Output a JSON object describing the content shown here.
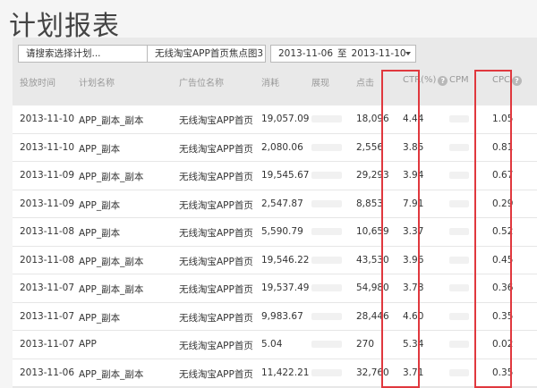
{
  "page": {
    "title": "计划报表"
  },
  "toolbar": {
    "plan_select": "请搜索选择计划...",
    "position_select": "无线淘宝APP首页焦点图3",
    "date_start": "2013-11-06",
    "date_sep": "至",
    "date_end": "2013-11-10"
  },
  "table": {
    "headers": {
      "date": "投放时间",
      "plan": "计划名称",
      "position": "广告位名称",
      "cost": "消耗",
      "impressions": "展现",
      "clicks": "点击",
      "ctr": "CTR(%)",
      "cpm": "CPM",
      "cpc": "CPC"
    },
    "rows": [
      {
        "date": "2013-11-10",
        "plan": "APP_副本_副本",
        "position": "无线淘宝APP首页",
        "cost": "19,057.09",
        "clicks": "18,096",
        "ctr": "4.44",
        "cpc": "1.05"
      },
      {
        "date": "2013-11-10",
        "plan": "APP_副本",
        "position": "无线淘宝APP首页",
        "cost": "2,080.06",
        "clicks": "2,556",
        "ctr": "3.85",
        "cpc": "0.81"
      },
      {
        "date": "2013-11-09",
        "plan": "APP_副本_副本",
        "position": "无线淘宝APP首页",
        "cost": "19,545.67",
        "clicks": "29,293",
        "ctr": "3.94",
        "cpc": "0.67"
      },
      {
        "date": "2013-11-09",
        "plan": "APP_副本",
        "position": "无线淘宝APP首页",
        "cost": "2,547.87",
        "clicks": "8,853",
        "ctr": "7.91",
        "cpc": "0.29"
      },
      {
        "date": "2013-11-08",
        "plan": "APP_副本",
        "position": "无线淘宝APP首页",
        "cost": "5,590.79",
        "clicks": "10,659",
        "ctr": "3.37",
        "cpc": "0.52"
      },
      {
        "date": "2013-11-08",
        "plan": "APP_副本_副本",
        "position": "无线淘宝APP首页",
        "cost": "19,546.22",
        "clicks": "43,530",
        "ctr": "3.96",
        "cpc": "0.45"
      },
      {
        "date": "2013-11-07",
        "plan": "APP_副本_副本",
        "position": "无线淘宝APP首页",
        "cost": "19,537.49",
        "clicks": "54,980",
        "ctr": "3.78",
        "cpc": "0.36"
      },
      {
        "date": "2013-11-07",
        "plan": "APP_副本",
        "position": "无线淘宝APP首页",
        "cost": "9,983.67",
        "clicks": "28,446",
        "ctr": "4.60",
        "cpc": "0.35"
      },
      {
        "date": "2013-11-07",
        "plan": "APP",
        "position": "无线淘宝APP首页",
        "cost": "5.04",
        "clicks": "270",
        "ctr": "5.34",
        "cpc": "0.02"
      },
      {
        "date": "2013-11-06",
        "plan": "APP_副本_副本",
        "position": "无线淘宝APP首页",
        "cost": "11,422.21",
        "clicks": "32,760",
        "ctr": "3.71",
        "cpc": "0.35"
      }
    ]
  },
  "colors": {
    "highlight": "#e0383e",
    "help_icon": "#b8b8b8"
  },
  "icons": {
    "help": "help-icon",
    "dropdown": "chevron-down-icon"
  }
}
